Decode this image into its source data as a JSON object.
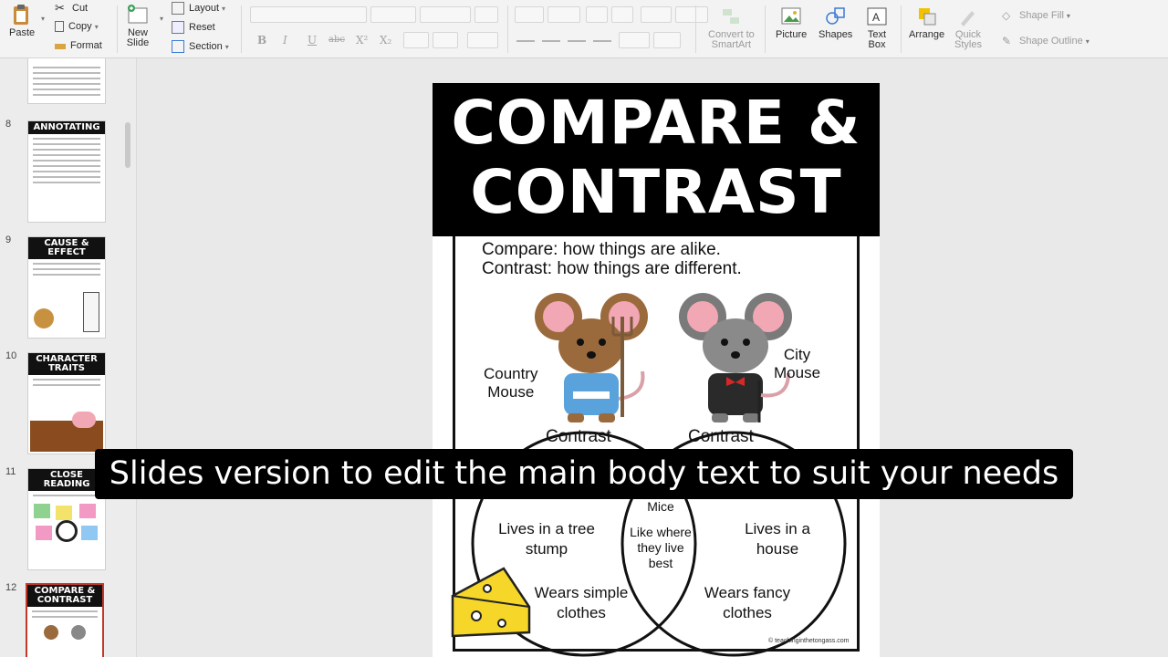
{
  "ribbon": {
    "paste": "Paste",
    "cut": "Cut",
    "copy": "Copy",
    "format": "Format",
    "new_slide": "New\nSlide",
    "layout": "Layout",
    "reset": "Reset",
    "section": "Section",
    "convert_smartart": "Convert to\nSmartArt",
    "picture": "Picture",
    "shapes": "Shapes",
    "text_box": "Text\nBox",
    "arrange": "Arrange",
    "quick_styles": "Quick\nStyles",
    "shape_fill": "Shape Fill",
    "shape_outline": "Shape Outline",
    "format_bold": "B",
    "format_italic": "I",
    "format_underline": "U",
    "format_strike": "abc",
    "format_superscript": "X²",
    "format_subscript": "X₂"
  },
  "thumbnails": [
    {
      "number": "",
      "title": ""
    },
    {
      "number": "8",
      "title": "ANNOTATING"
    },
    {
      "number": "9",
      "title": "CAUSE &\nEFFECT"
    },
    {
      "number": "10",
      "title": "CHARACTER\nTRAITS"
    },
    {
      "number": "11",
      "title": "CLOSE\nREADING"
    },
    {
      "number": "12",
      "title": "COMPARE &\nCONTRAST"
    }
  ],
  "slide": {
    "title_line1": "COMPARE &",
    "title_line2": "CONTRAST",
    "compare_def": "Compare: how things are alike.",
    "contrast_def": "Contrast: how things are different.",
    "country_label": "Country\nMouse",
    "city_label": "City\nMouse",
    "contrast_left": "Contrast",
    "contrast_right": "Contrast",
    "left_item1": "Lives in a tree\nstump",
    "left_item2": "Wears simple\nclothes",
    "mid_title": "Mice",
    "mid_item": "Like where\nthey live\nbest",
    "right_item1": "Lives in a\nhouse",
    "right_item2": "Wears fancy\nclothes",
    "credit": "© teachinginthetongass.com"
  },
  "caption": "Slides version to edit the main body text to suit your needs"
}
